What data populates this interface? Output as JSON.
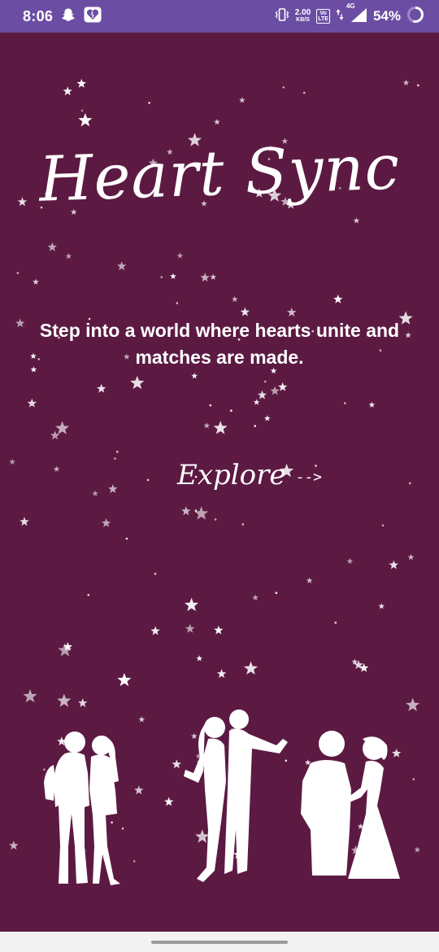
{
  "status_bar": {
    "time": "8:06",
    "net_speed_value": "2.00",
    "net_speed_unit": "KB/S",
    "volte_top": "Vo",
    "volte_bottom": "LTE",
    "network_type": "4G",
    "battery_percent": "54%",
    "icons": [
      "snapchat-icon",
      "heart-app-icon",
      "vibrate-icon",
      "volte-icon",
      "data-arrows-icon",
      "signal-icon",
      "battery-icon"
    ]
  },
  "app": {
    "title": "Heart Sync",
    "tagline_line1": "Step into a world where hearts unite and",
    "tagline_line2": "matches are made.",
    "explore_label": "Explore",
    "explore_arrow": "-->"
  },
  "colors": {
    "background": "#5c1a43",
    "status_bar": "#6b4ea3",
    "text": "#ffffff",
    "nav_bar": "#f2f2f2"
  },
  "illustration": {
    "icons": [
      "couple-silhouette-icon",
      "dancing-couple-silhouette-icon",
      "wedding-couple-silhouette-icon",
      "stars-decoration-icon"
    ]
  }
}
